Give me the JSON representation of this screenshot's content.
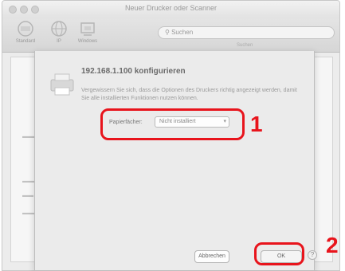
{
  "window": {
    "title": "Neuer Drucker oder Scanner"
  },
  "toolbar": {
    "buttons": [
      {
        "label": "Standard",
        "icon": "default-printer-icon"
      },
      {
        "label": "IP",
        "icon": "globe-icon"
      },
      {
        "label": "Windows",
        "icon": "windows-printer-icon"
      }
    ],
    "search_placeholder": "Suchen",
    "search_label": "Suchen"
  },
  "sheet": {
    "title": "192.168.1.100 konfigurieren",
    "description": "Vergewissern Sie sich, dass die Optionen des Druckers richtig angezeigt werden, damit Sie alle installierten Funktionen nutzen können.",
    "option_label": "Papierfächer:",
    "option_value": "Nicht installiert",
    "cancel_label": "Abbrechen",
    "ok_label": "OK"
  },
  "annotations": {
    "callout_1": "1",
    "callout_2": "2",
    "color": "#e8141c"
  }
}
